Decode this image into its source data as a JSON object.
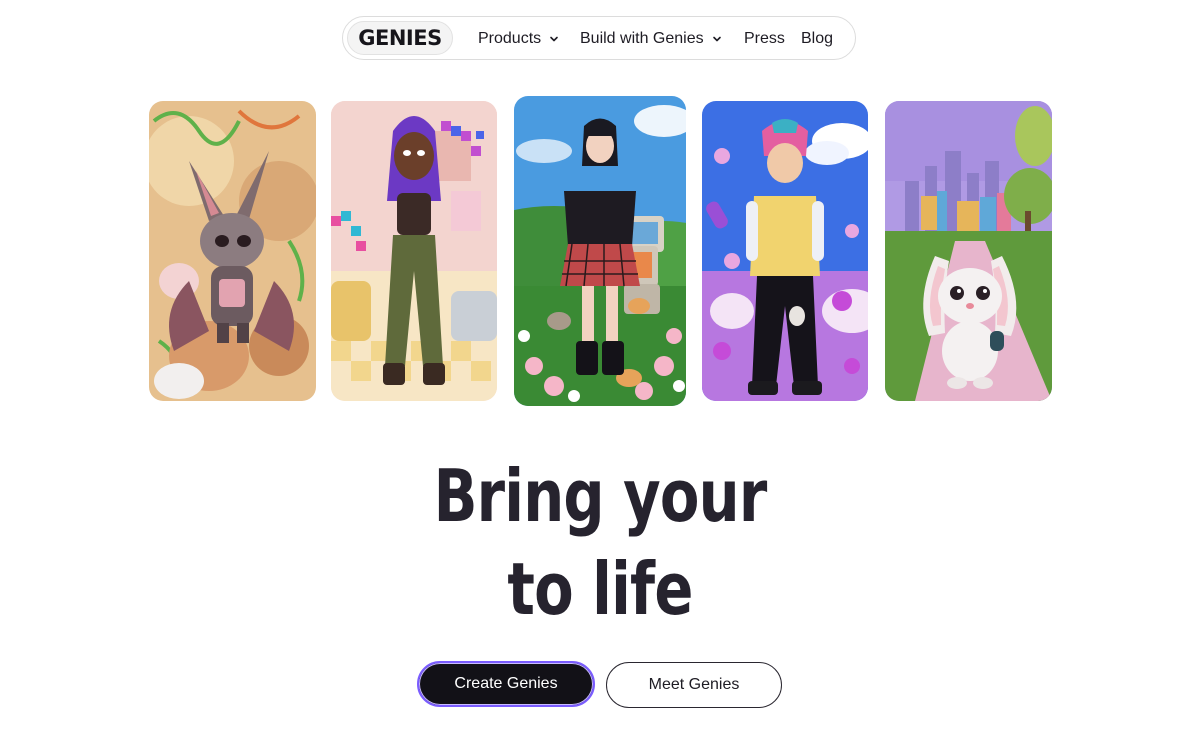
{
  "nav": {
    "logo": "GENIES",
    "items": [
      {
        "label": "Products",
        "has_dropdown": true
      },
      {
        "label": "Build with Genies",
        "has_dropdown": true
      },
      {
        "label": "Press",
        "has_dropdown": false
      },
      {
        "label": "Blog",
        "has_dropdown": false
      }
    ]
  },
  "cards": [
    {
      "subject": "bat-creature-avatar"
    },
    {
      "subject": "girl-avatar-purple-hair"
    },
    {
      "subject": "goth-girl-avatar"
    },
    {
      "subject": "boy-avatar-pink-hair"
    },
    {
      "subject": "white-bunny-avatar"
    }
  ],
  "hero": {
    "line1": "Bring your",
    "line2": "to life"
  },
  "cta": {
    "primary": "Create Genies",
    "secondary": "Meet Genies"
  },
  "colors": {
    "text": "#1e1c24",
    "primary_bg": "#121117",
    "primary_border": "#7a5cff"
  }
}
